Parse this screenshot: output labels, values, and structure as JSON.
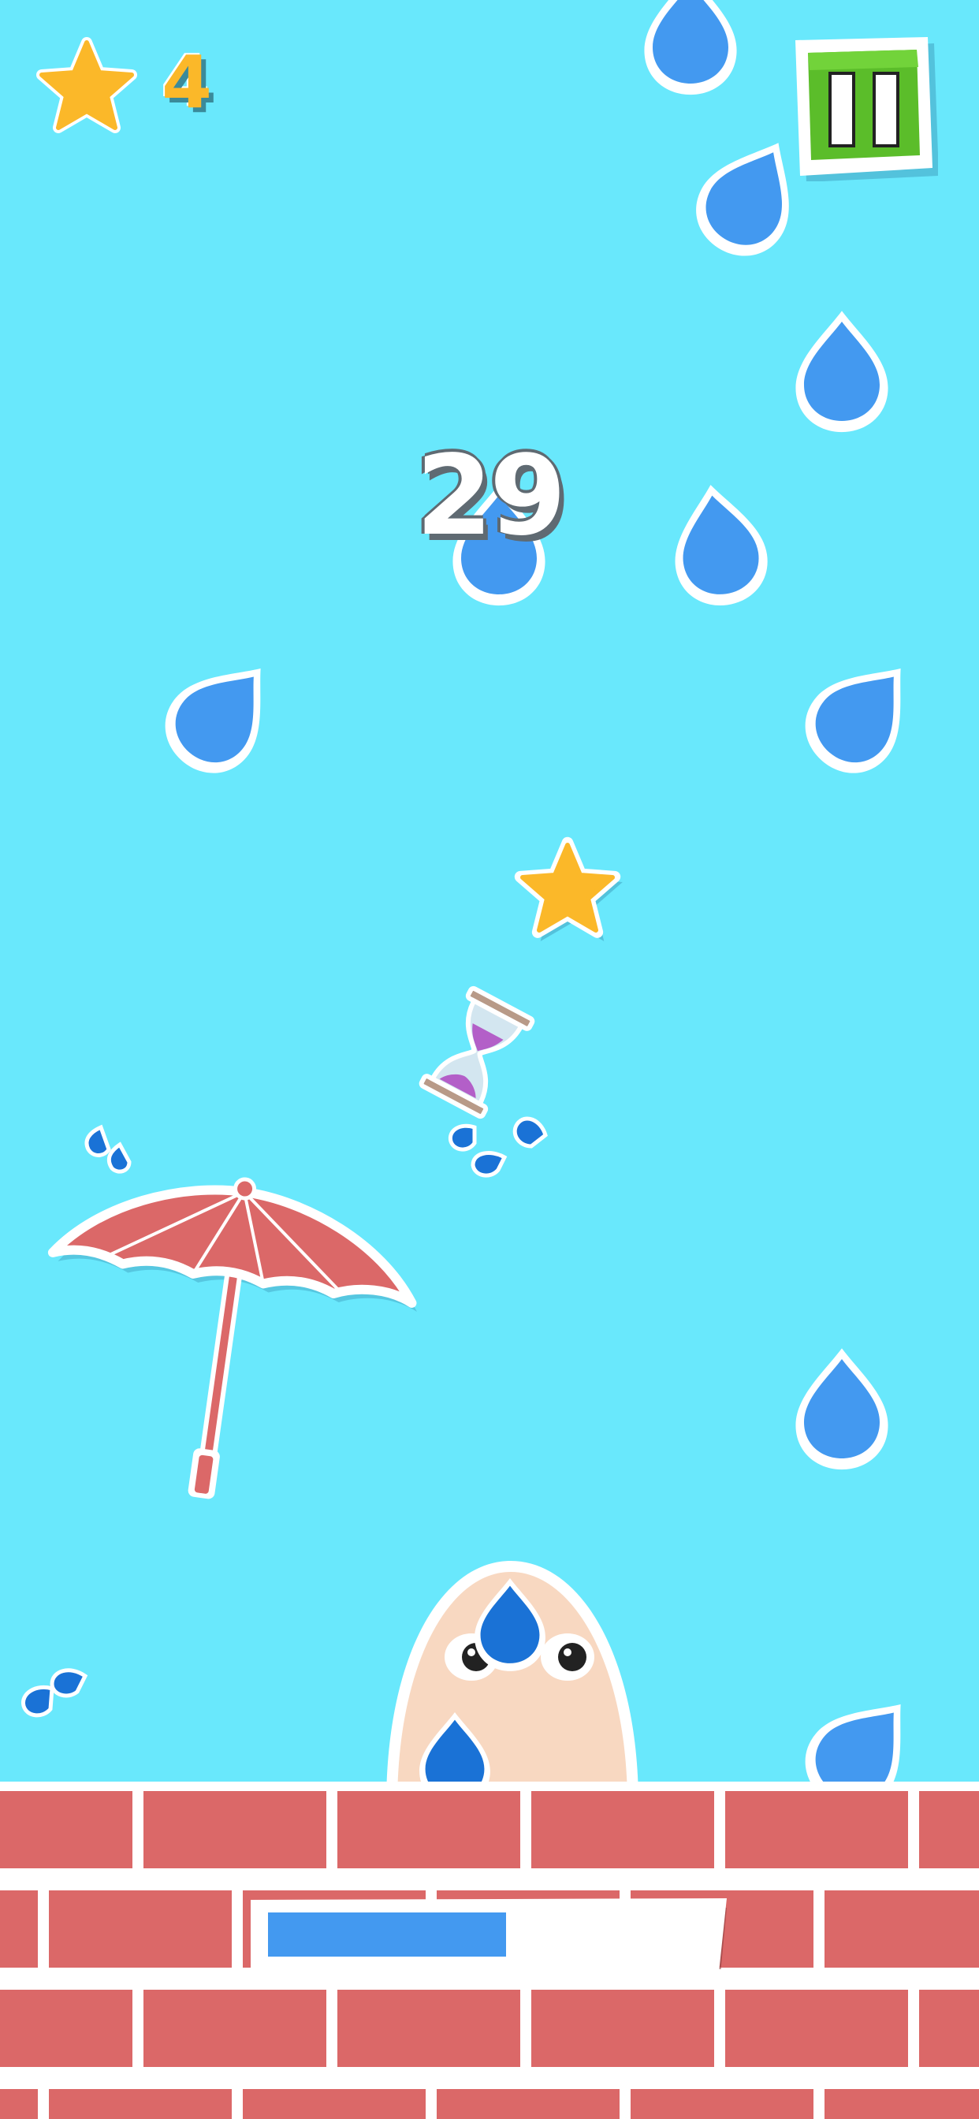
{
  "hud": {
    "star_icon": "star-icon",
    "star_count": "4",
    "score": "29",
    "pause_icon": "pause-icon"
  },
  "progress": {
    "fill_fraction": 0.54
  },
  "colors": {
    "sky": "#69e8fc",
    "drop": "#4399f0",
    "drop_small": "#1a72d6",
    "brick": "#db6868",
    "mortar": "#ffffff",
    "star": "#fbb829",
    "pause_green": "#5bbd2a",
    "umbrella": "#db6868",
    "character": "#f8d8c1",
    "progress_fill": "#4399f0"
  }
}
